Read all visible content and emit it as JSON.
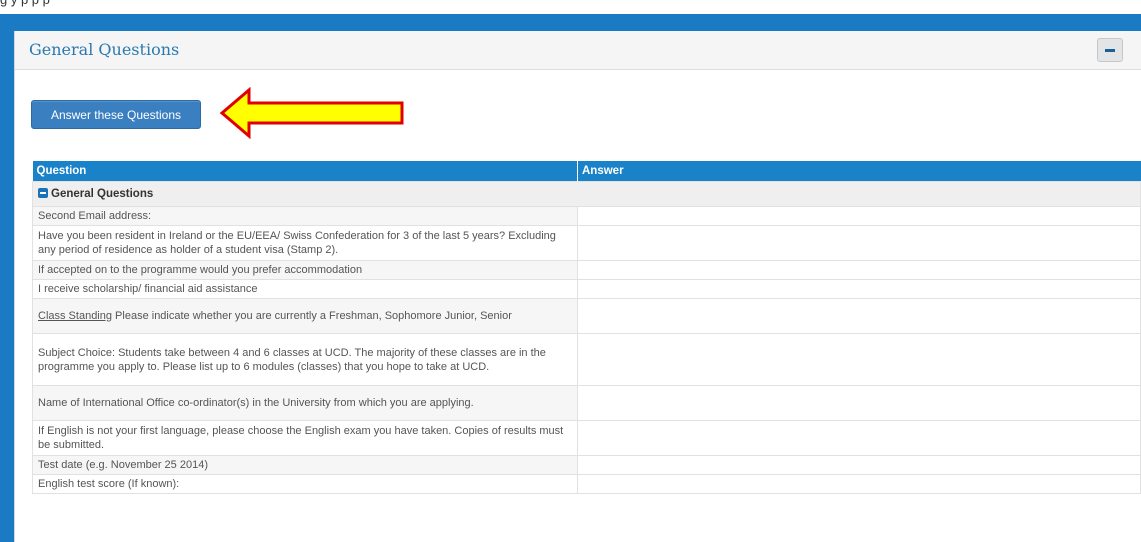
{
  "top_strip_text": "g                                                    y                    p    p    p",
  "panel": {
    "title": "General Questions",
    "collapse_icon": "minus-icon"
  },
  "answer_button": {
    "label": "Answer these Questions"
  },
  "annotation": {
    "arrow_color": "#ffff00",
    "arrow_outline": "#e00000"
  },
  "table": {
    "columns": [
      "Question",
      "Answer"
    ],
    "group_label": "General Questions",
    "rows": [
      {
        "question_prefix": "",
        "question": "Second Email address:",
        "answer": ""
      },
      {
        "question_prefix": "",
        "question": "Have you been resident in Ireland or the EU/EEA/ Swiss Confederation for 3 of the last 5 years? Excluding any period of residence as holder of a student visa (Stamp 2).",
        "answer": ""
      },
      {
        "question_prefix": "",
        "question": "If accepted on to the programme would you prefer accommodation",
        "answer": ""
      },
      {
        "question_prefix": "",
        "question": "I receive scholarship/ financial aid assistance",
        "answer": ""
      },
      {
        "question_prefix": "Class Standing",
        "question": " Please indicate whether you are currently a Freshman, Sophomore Junior, Senior",
        "answer": ""
      },
      {
        "question_prefix": "",
        "question": "Subject Choice: Students take between 4 and 6 classes at UCD. The majority of these classes are in the programme you apply to. Please list up to 6 modules (classes) that you hope to take at UCD.",
        "answer": ""
      },
      {
        "question_prefix": "",
        "question": "Name of International Office co-ordinator(s) in the University from which you are applying.",
        "answer": ""
      },
      {
        "question_prefix": "",
        "question": "If English is not your first language, please choose the English exam you have taken. Copies of results must be submitted.",
        "answer": ""
      },
      {
        "question_prefix": "",
        "question": "Test date (e.g. November 25 2014)",
        "answer": ""
      },
      {
        "question_prefix": "",
        "question": "English test score (If known):",
        "answer": ""
      }
    ]
  },
  "colors": {
    "frame_blue": "#1a7bc4",
    "header_blue": "#1a82c8",
    "button_blue": "#3a7fc0",
    "title_blue": "#2a7ab0"
  }
}
